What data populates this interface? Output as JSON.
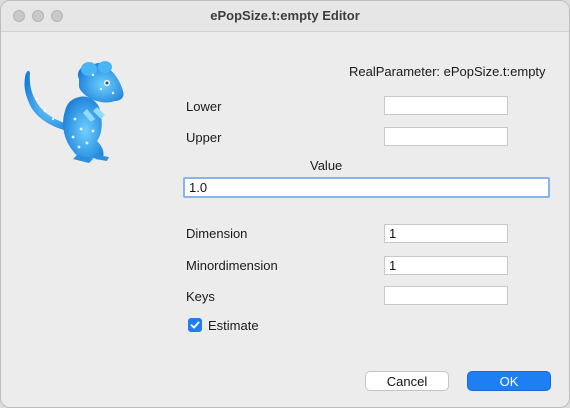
{
  "window": {
    "title": "ePopSize.t:empty Editor"
  },
  "header": {
    "parameter_label": "RealParameter: ePopSize.t:empty"
  },
  "form": {
    "lower": {
      "label": "Lower",
      "value": ""
    },
    "upper": {
      "label": "Upper",
      "value": ""
    },
    "value": {
      "label": "Value",
      "value": "1.0"
    },
    "dimension": {
      "label": "Dimension",
      "value": "1"
    },
    "minordimension": {
      "label": "Minordimension",
      "value": "1"
    },
    "keys": {
      "label": "Keys",
      "value": ""
    },
    "estimate": {
      "label": "Estimate",
      "checked": true
    }
  },
  "buttons": {
    "cancel": "Cancel",
    "ok": "OK"
  },
  "icons": {
    "logo": "beast-rat-logo-icon",
    "checkbox": "checkmark-icon"
  },
  "colors": {
    "accent": "#1e7ff5",
    "logo": "#2aa7f2"
  }
}
